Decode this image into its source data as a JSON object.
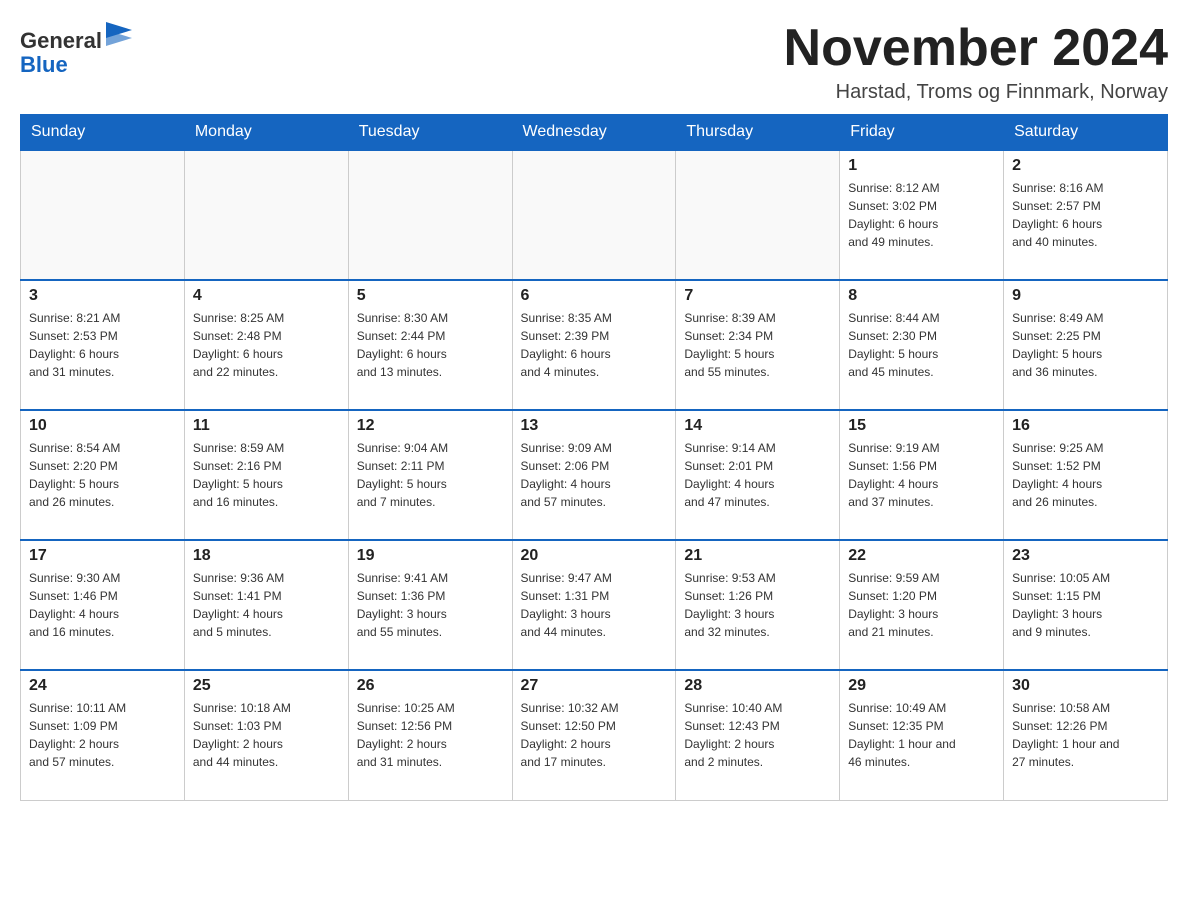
{
  "header": {
    "logo_text_general": "General",
    "logo_text_blue": "Blue",
    "month_title": "November 2024",
    "location": "Harstad, Troms og Finnmark, Norway"
  },
  "weekdays": [
    "Sunday",
    "Monday",
    "Tuesday",
    "Wednesday",
    "Thursday",
    "Friday",
    "Saturday"
  ],
  "weeks": [
    [
      {
        "day": "",
        "info": ""
      },
      {
        "day": "",
        "info": ""
      },
      {
        "day": "",
        "info": ""
      },
      {
        "day": "",
        "info": ""
      },
      {
        "day": "",
        "info": ""
      },
      {
        "day": "1",
        "info": "Sunrise: 8:12 AM\nSunset: 3:02 PM\nDaylight: 6 hours\nand 49 minutes."
      },
      {
        "day": "2",
        "info": "Sunrise: 8:16 AM\nSunset: 2:57 PM\nDaylight: 6 hours\nand 40 minutes."
      }
    ],
    [
      {
        "day": "3",
        "info": "Sunrise: 8:21 AM\nSunset: 2:53 PM\nDaylight: 6 hours\nand 31 minutes."
      },
      {
        "day": "4",
        "info": "Sunrise: 8:25 AM\nSunset: 2:48 PM\nDaylight: 6 hours\nand 22 minutes."
      },
      {
        "day": "5",
        "info": "Sunrise: 8:30 AM\nSunset: 2:44 PM\nDaylight: 6 hours\nand 13 minutes."
      },
      {
        "day": "6",
        "info": "Sunrise: 8:35 AM\nSunset: 2:39 PM\nDaylight: 6 hours\nand 4 minutes."
      },
      {
        "day": "7",
        "info": "Sunrise: 8:39 AM\nSunset: 2:34 PM\nDaylight: 5 hours\nand 55 minutes."
      },
      {
        "day": "8",
        "info": "Sunrise: 8:44 AM\nSunset: 2:30 PM\nDaylight: 5 hours\nand 45 minutes."
      },
      {
        "day": "9",
        "info": "Sunrise: 8:49 AM\nSunset: 2:25 PM\nDaylight: 5 hours\nand 36 minutes."
      }
    ],
    [
      {
        "day": "10",
        "info": "Sunrise: 8:54 AM\nSunset: 2:20 PM\nDaylight: 5 hours\nand 26 minutes."
      },
      {
        "day": "11",
        "info": "Sunrise: 8:59 AM\nSunset: 2:16 PM\nDaylight: 5 hours\nand 16 minutes."
      },
      {
        "day": "12",
        "info": "Sunrise: 9:04 AM\nSunset: 2:11 PM\nDaylight: 5 hours\nand 7 minutes."
      },
      {
        "day": "13",
        "info": "Sunrise: 9:09 AM\nSunset: 2:06 PM\nDaylight: 4 hours\nand 57 minutes."
      },
      {
        "day": "14",
        "info": "Sunrise: 9:14 AM\nSunset: 2:01 PM\nDaylight: 4 hours\nand 47 minutes."
      },
      {
        "day": "15",
        "info": "Sunrise: 9:19 AM\nSunset: 1:56 PM\nDaylight: 4 hours\nand 37 minutes."
      },
      {
        "day": "16",
        "info": "Sunrise: 9:25 AM\nSunset: 1:52 PM\nDaylight: 4 hours\nand 26 minutes."
      }
    ],
    [
      {
        "day": "17",
        "info": "Sunrise: 9:30 AM\nSunset: 1:46 PM\nDaylight: 4 hours\nand 16 minutes."
      },
      {
        "day": "18",
        "info": "Sunrise: 9:36 AM\nSunset: 1:41 PM\nDaylight: 4 hours\nand 5 minutes."
      },
      {
        "day": "19",
        "info": "Sunrise: 9:41 AM\nSunset: 1:36 PM\nDaylight: 3 hours\nand 55 minutes."
      },
      {
        "day": "20",
        "info": "Sunrise: 9:47 AM\nSunset: 1:31 PM\nDaylight: 3 hours\nand 44 minutes."
      },
      {
        "day": "21",
        "info": "Sunrise: 9:53 AM\nSunset: 1:26 PM\nDaylight: 3 hours\nand 32 minutes."
      },
      {
        "day": "22",
        "info": "Sunrise: 9:59 AM\nSunset: 1:20 PM\nDaylight: 3 hours\nand 21 minutes."
      },
      {
        "day": "23",
        "info": "Sunrise: 10:05 AM\nSunset: 1:15 PM\nDaylight: 3 hours\nand 9 minutes."
      }
    ],
    [
      {
        "day": "24",
        "info": "Sunrise: 10:11 AM\nSunset: 1:09 PM\nDaylight: 2 hours\nand 57 minutes."
      },
      {
        "day": "25",
        "info": "Sunrise: 10:18 AM\nSunset: 1:03 PM\nDaylight: 2 hours\nand 44 minutes."
      },
      {
        "day": "26",
        "info": "Sunrise: 10:25 AM\nSunset: 12:56 PM\nDaylight: 2 hours\nand 31 minutes."
      },
      {
        "day": "27",
        "info": "Sunrise: 10:32 AM\nSunset: 12:50 PM\nDaylight: 2 hours\nand 17 minutes."
      },
      {
        "day": "28",
        "info": "Sunrise: 10:40 AM\nSunset: 12:43 PM\nDaylight: 2 hours\nand 2 minutes."
      },
      {
        "day": "29",
        "info": "Sunrise: 10:49 AM\nSunset: 12:35 PM\nDaylight: 1 hour and\n46 minutes."
      },
      {
        "day": "30",
        "info": "Sunrise: 10:58 AM\nSunset: 12:26 PM\nDaylight: 1 hour and\n27 minutes."
      }
    ]
  ]
}
